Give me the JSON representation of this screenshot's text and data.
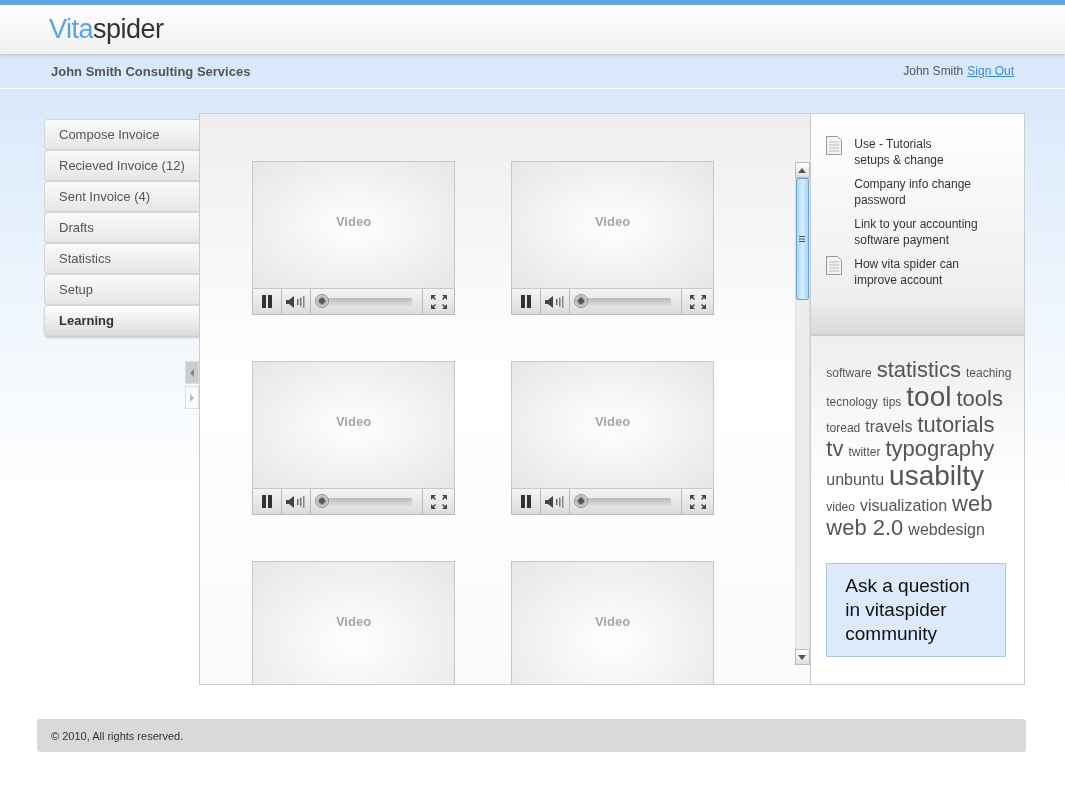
{
  "logo": {
    "part_1": "Vita",
    "part_2": "spider"
  },
  "company": "John Smith Consulting Services",
  "user": {
    "name": "John Smith",
    "sign_out": "Sign Out"
  },
  "sidebar": {
    "items": [
      {
        "label": "Compose Invoice",
        "selected": false
      },
      {
        "label": "Recieved Invoice (12)",
        "selected": false
      },
      {
        "label": "Sent Invoice (4)",
        "selected": false
      },
      {
        "label": "Drafts",
        "selected": false
      },
      {
        "label": "Statistics",
        "selected": false
      },
      {
        "label": "Setup",
        "selected": false
      },
      {
        "label": "Learning",
        "selected": true
      }
    ]
  },
  "videos": [
    {
      "label": "Video",
      "player": {
        "level": 0.02
      }
    },
    {
      "label": "Video",
      "player": {
        "level": 0.02
      }
    },
    {
      "label": "Video",
      "player": {
        "level": 0.02
      }
    },
    {
      "label": "Video",
      "player": {
        "level": 0.02
      }
    },
    {
      "label": "Video"
    },
    {
      "label": "Video"
    }
  ],
  "help_links": [
    {
      "lines": [
        "Use - Tutorials",
        "setups & change"
      ],
      "icon": true
    },
    {
      "lines": [
        "Company info change",
        "password"
      ],
      "icon": false
    },
    {
      "lines": [
        "Link to your accounting",
        "software payment"
      ],
      "icon": false
    },
    {
      "lines": [
        "How vita spider can",
        "improve account"
      ],
      "icon": true
    }
  ],
  "tags": [
    {
      "text": "software",
      "kind": "small"
    },
    {
      "text": "statistics",
      "kind": "large"
    },
    {
      "text": "teaching",
      "kind": "small"
    },
    {
      "text": "tecnology",
      "kind": "small"
    },
    {
      "text": "tips",
      "kind": "small"
    },
    {
      "text": "tool",
      "kind": "huge"
    },
    {
      "text": "tools",
      "kind": "large"
    },
    {
      "text": "toread",
      "kind": "small"
    },
    {
      "text": "travels",
      "kind": "medium"
    },
    {
      "text": "tutorials",
      "kind": "large"
    },
    {
      "text": "tv",
      "kind": "large"
    },
    {
      "text": "twitter",
      "kind": "small"
    },
    {
      "text": "typography",
      "kind": "large"
    },
    {
      "text": "unbuntu",
      "kind": "medium"
    },
    {
      "text": "usabilty",
      "kind": "huge"
    },
    {
      "text": "video",
      "kind": "small"
    },
    {
      "text": "visualization",
      "kind": "medium"
    },
    {
      "text": "web",
      "kind": "large"
    },
    {
      "text": "web 2.0",
      "kind": "large"
    },
    {
      "text": "webdesign",
      "kind": "medium"
    }
  ],
  "ask_box": {
    "lines": [
      "Ask a question",
      "in vitaspider",
      "community"
    ]
  },
  "footer": "© 2010, All rights reserved."
}
